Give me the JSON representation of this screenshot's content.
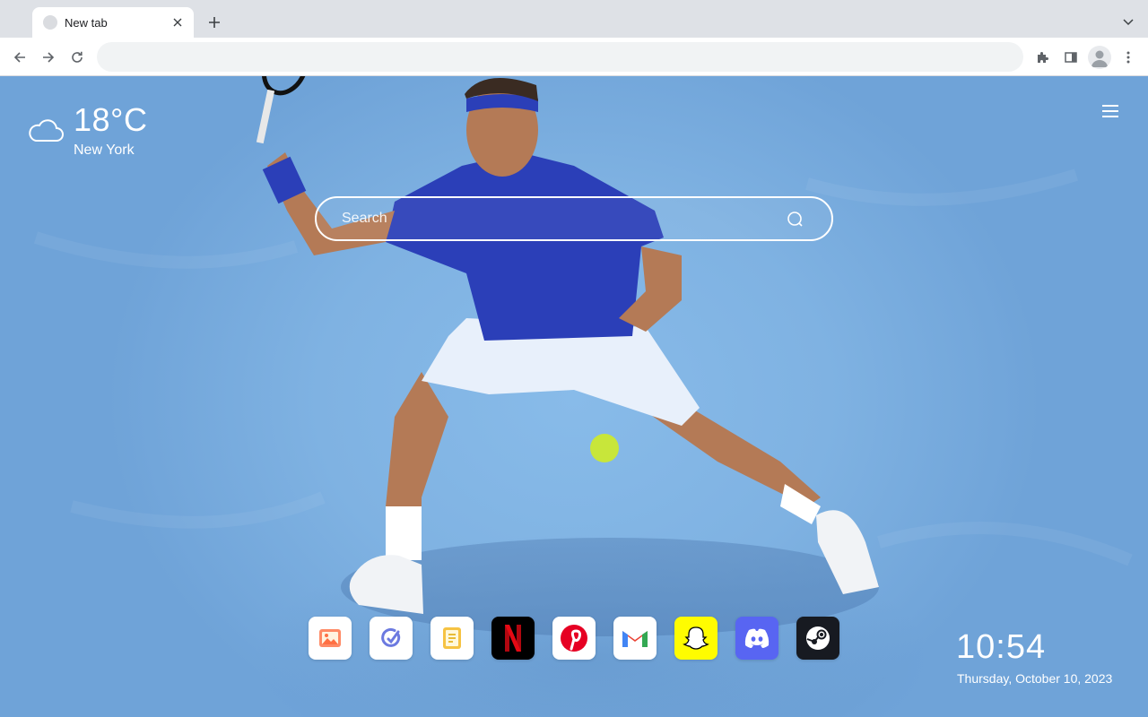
{
  "browser": {
    "tab": {
      "title": "New tab"
    },
    "omnibox": {
      "value": "",
      "placeholder": ""
    }
  },
  "weather": {
    "temperature": "18°C",
    "city": "New York",
    "icon": "cloud-icon"
  },
  "search": {
    "placeholder": "Search"
  },
  "shortcuts": [
    {
      "name": "photos",
      "icon": "image-icon",
      "bg": "#ffffff"
    },
    {
      "name": "tasks",
      "icon": "checkmark-circle-icon",
      "bg": "#ffffff"
    },
    {
      "name": "notes",
      "icon": "notepad-icon",
      "bg": "#ffffff"
    },
    {
      "name": "netflix",
      "icon": "netflix-icon",
      "bg": "#000000"
    },
    {
      "name": "pinterest",
      "icon": "pinterest-icon",
      "bg": "#ffffff"
    },
    {
      "name": "gmail",
      "icon": "gmail-icon",
      "bg": "#ffffff"
    },
    {
      "name": "snapchat",
      "icon": "snapchat-icon",
      "bg": "#fffc00"
    },
    {
      "name": "discord",
      "icon": "discord-icon",
      "bg": "#5865f2"
    },
    {
      "name": "steam",
      "icon": "steam-icon",
      "bg": "#171a21"
    }
  ],
  "clock": {
    "time": "10:54",
    "date": "Thursday, October 10, 2023"
  },
  "colors": {
    "wallpaper": "#7fb2e2",
    "tabstrip": "#dee1e6",
    "toolbar": "#ffffff"
  }
}
